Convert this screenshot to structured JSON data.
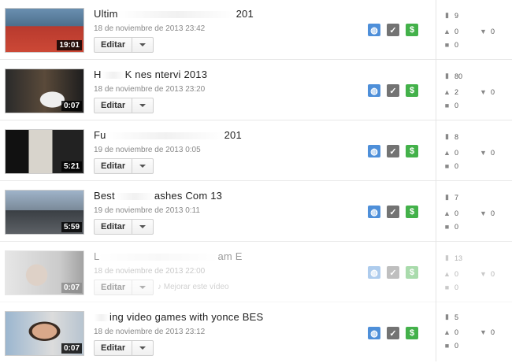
{
  "videos": [
    {
      "title": "Ultim",
      "title_end": "201",
      "date": "18 de noviembre de 2013 23:42",
      "duration": "19:01",
      "edit_label": "Editar",
      "views": "9",
      "likes": "0",
      "dislikes": "0",
      "comments": "0",
      "dimmed": false
    },
    {
      "title": "H",
      "title_end": "K   nes      ntervi                      2013",
      "date": "18 de noviembre de 2013 23:20",
      "duration": "0:07",
      "edit_label": "Editar",
      "views": "80",
      "likes": "2",
      "dislikes": "0",
      "comments": "0",
      "dimmed": false
    },
    {
      "title": "Fu",
      "title_end": "201",
      "date": "19 de noviembre de 2013 0:05",
      "duration": "5:21",
      "edit_label": "Editar",
      "views": "8",
      "likes": "0",
      "dislikes": "0",
      "comments": "0",
      "dimmed": false
    },
    {
      "title": "Best",
      "title_end": "ashes     Com            13",
      "date": "19 de noviembre de 2013 0:11",
      "duration": "5:59",
      "edit_label": "Editar",
      "views": "7",
      "likes": "0",
      "dislikes": "0",
      "comments": "0",
      "dimmed": false
    },
    {
      "title": "L",
      "title_end": "am          E",
      "date": "18 de noviembre de 2013 22:00",
      "duration": "0:07",
      "edit_label": "Editar",
      "improve_label": "Mejorar este vídeo",
      "views": "13",
      "likes": "0",
      "dislikes": "0",
      "comments": "0",
      "dimmed": true
    },
    {
      "title": "",
      "title_end": "ing video games with     yonce BES",
      "date": "18 de noviembre de 2013 23:12",
      "duration": "0:07",
      "edit_label": "Editar",
      "views": "5",
      "likes": "0",
      "dislikes": "0",
      "comments": "0",
      "dimmed": false
    }
  ],
  "icons": {
    "privacy": "globe-icon",
    "status": "check-icon",
    "monetization": "dollar-icon"
  },
  "colors": {
    "globe": "#4e8fd9",
    "check": "#737373",
    "dollar": "#43b14a"
  }
}
